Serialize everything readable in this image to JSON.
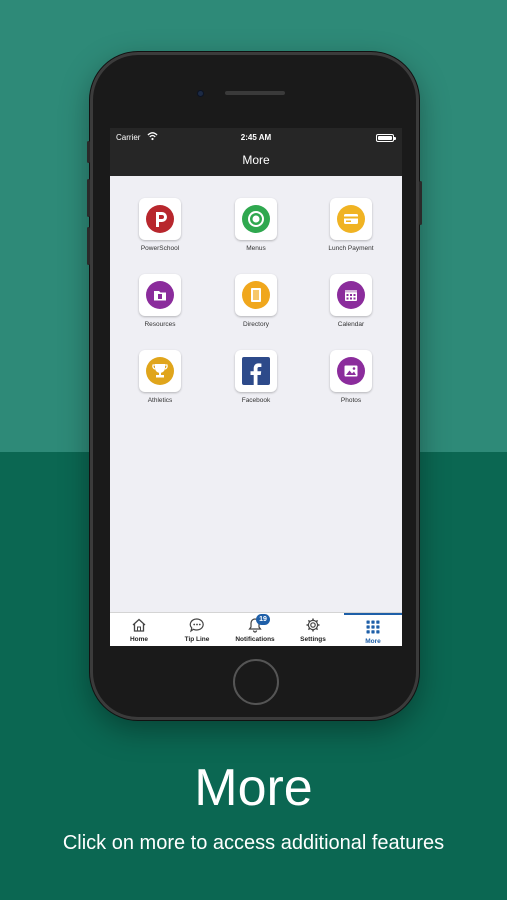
{
  "status_bar": {
    "carrier": "Carrier",
    "time": "2:45 AM"
  },
  "navbar": {
    "title": "More"
  },
  "tiles": [
    {
      "label": "PowerSchool",
      "icon": "powerschool-icon",
      "color": "#b8272d"
    },
    {
      "label": "Menus",
      "icon": "menus-icon",
      "color": "#2fa84f"
    },
    {
      "label": "Lunch Payment",
      "icon": "lunch-payment-icon",
      "color": "#f0b323"
    },
    {
      "label": "Resources",
      "icon": "resources-icon",
      "color": "#8b2c9c"
    },
    {
      "label": "Directory",
      "icon": "directory-icon",
      "color": "#f0a71d"
    },
    {
      "label": "Calendar",
      "icon": "calendar-icon",
      "color": "#8b2c9c"
    },
    {
      "label": "Athletics",
      "icon": "trophy-icon",
      "color": "#e0a51b"
    },
    {
      "label": "Facebook",
      "icon": "facebook-icon",
      "color": "#2d4a8a"
    },
    {
      "label": "Photos",
      "icon": "photos-icon",
      "color": "#8b2c9c"
    }
  ],
  "tabbar": {
    "tabs": [
      {
        "label": "Home",
        "icon": "home-icon"
      },
      {
        "label": "Tip Line",
        "icon": "chat-bubble-icon"
      },
      {
        "label": "Notifications",
        "icon": "bell-icon",
        "badge": "19"
      },
      {
        "label": "Settings",
        "icon": "gear-icon"
      },
      {
        "label": "More",
        "icon": "grid-icon",
        "active": true
      }
    ],
    "accent": "#1e5fa8"
  },
  "caption": {
    "headline": "More",
    "subline": "Click on more to access additional features"
  },
  "colors": {
    "bg_top": "#2e8a78",
    "bg_bottom": "#0b6752"
  }
}
